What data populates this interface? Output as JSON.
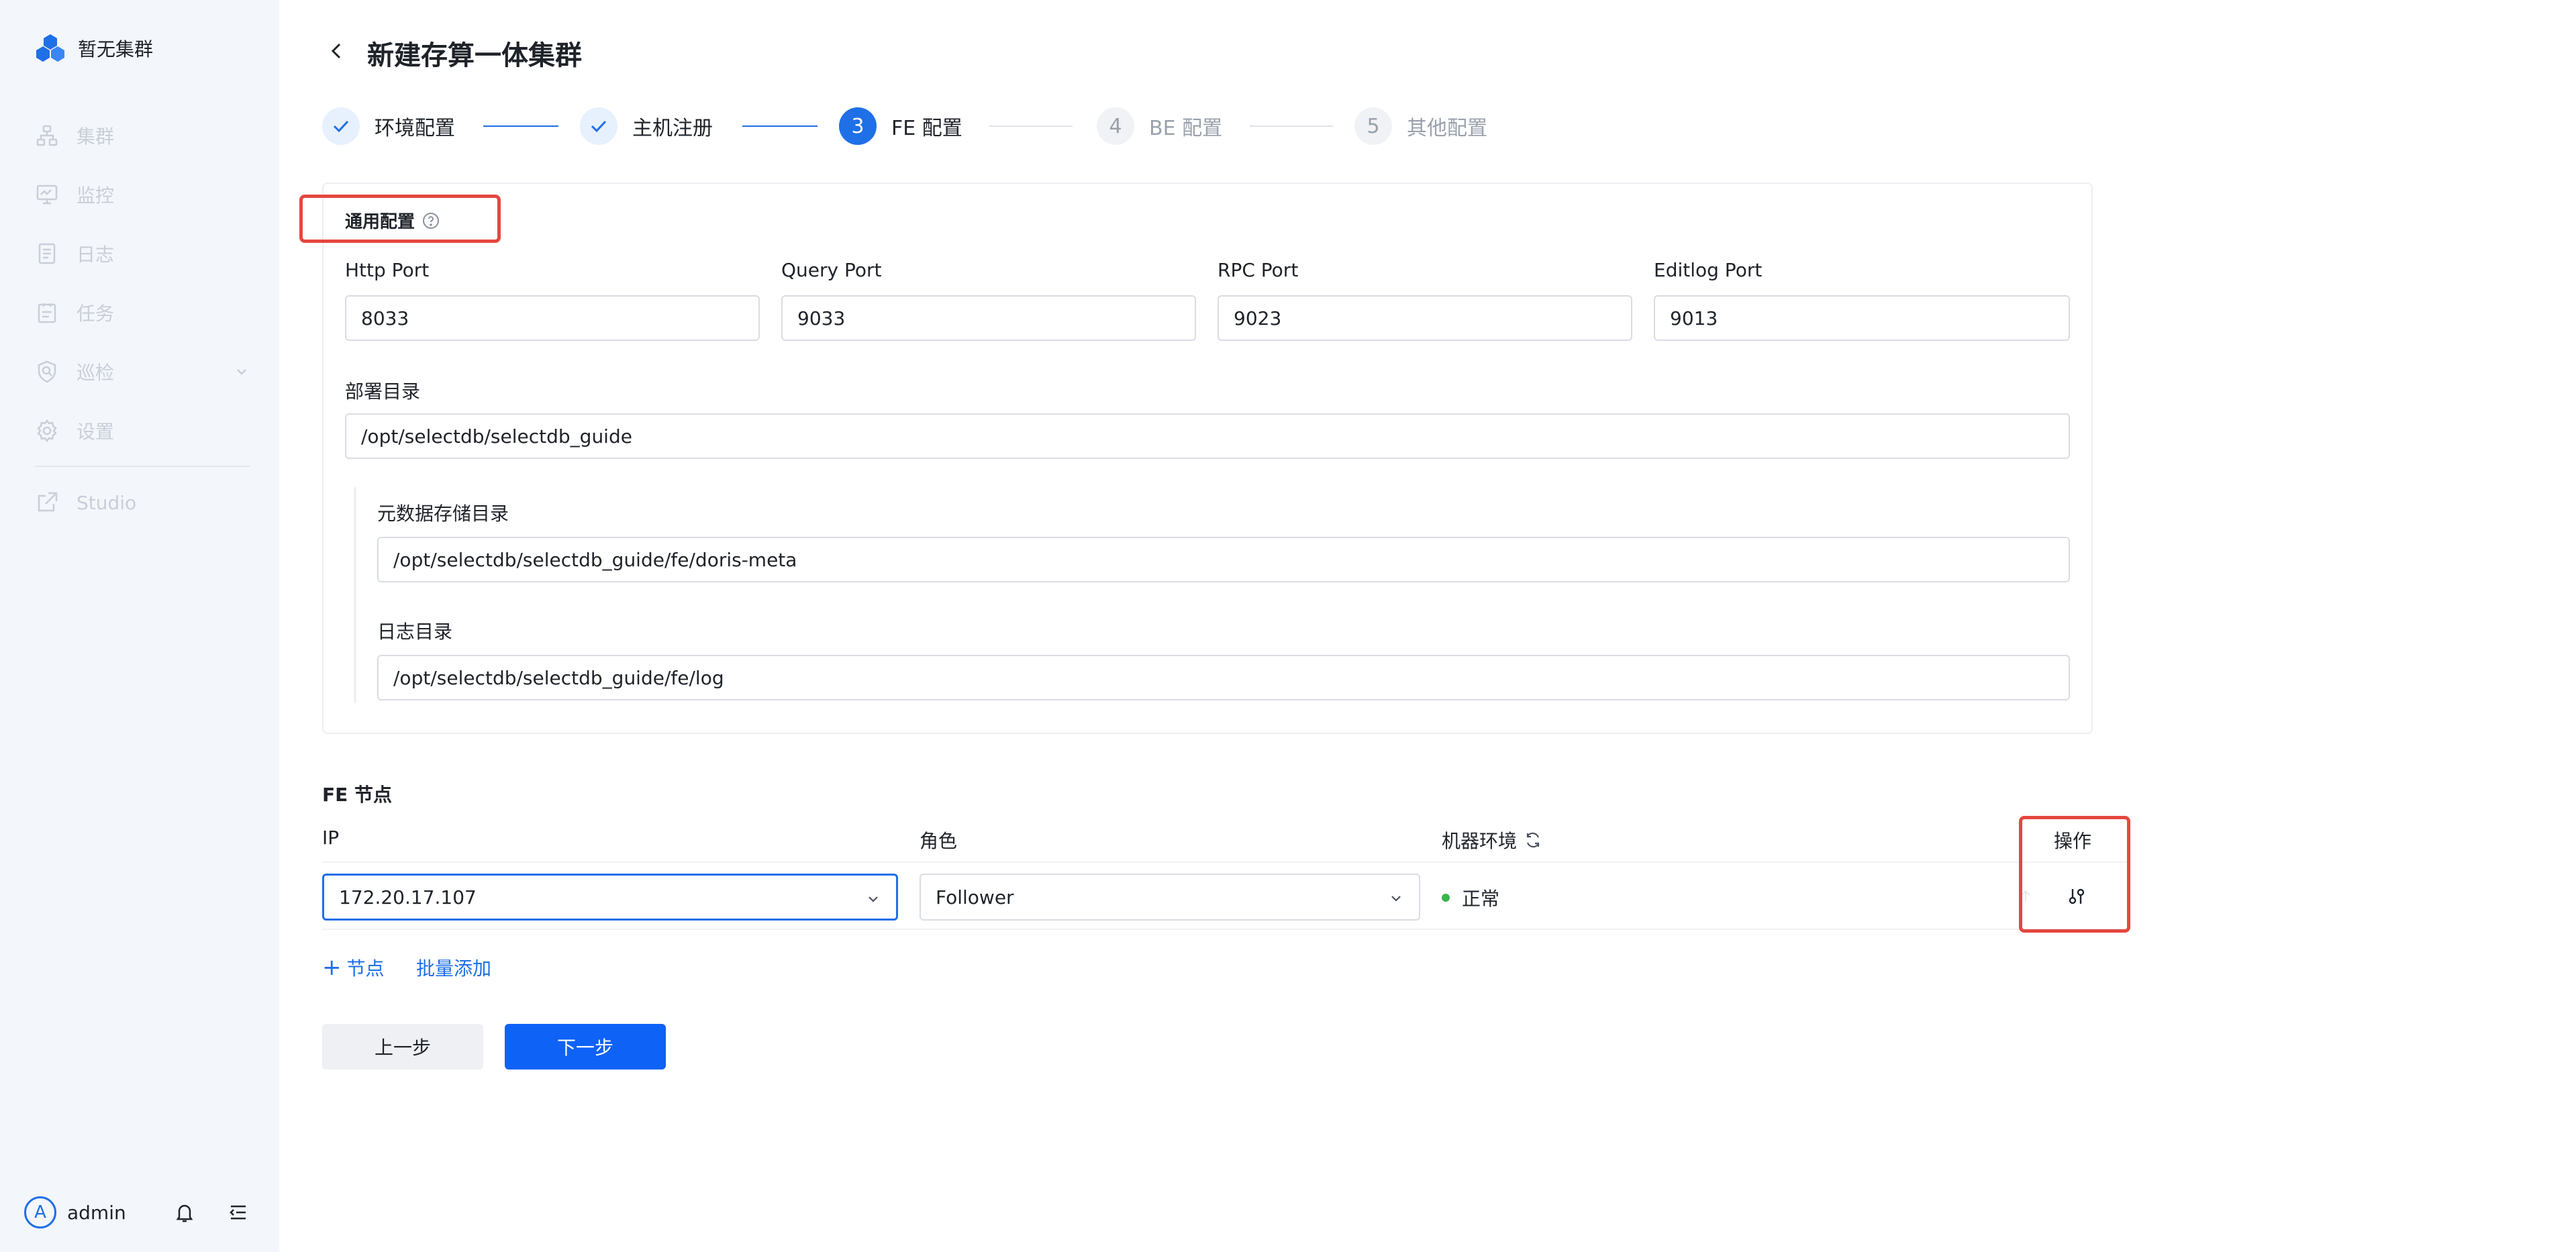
{
  "sidebar": {
    "brand": "暂无集群",
    "items": [
      {
        "label": "集群",
        "icon": "cluster-icon"
      },
      {
        "label": "监控",
        "icon": "monitor-icon"
      },
      {
        "label": "日志",
        "icon": "log-icon"
      },
      {
        "label": "任务",
        "icon": "task-icon"
      },
      {
        "label": "巡检",
        "icon": "inspect-icon"
      },
      {
        "label": "设置",
        "icon": "settings-icon"
      }
    ],
    "studio": {
      "label": "Studio",
      "icon": "external-link-icon"
    },
    "user": {
      "avatar_letter": "A",
      "name": "admin"
    }
  },
  "header": {
    "title": "新建存算一体集群"
  },
  "steps": [
    {
      "number": "1",
      "label": "环境配置",
      "status": "done"
    },
    {
      "number": "2",
      "label": "主机注册",
      "status": "done"
    },
    {
      "number": "3",
      "label": "FE 配置",
      "status": "active"
    },
    {
      "number": "4",
      "label": "BE 配置",
      "status": "pending"
    },
    {
      "number": "5",
      "label": "其他配置",
      "status": "pending"
    }
  ],
  "common_config": {
    "title": "通用配置",
    "ports": [
      {
        "label": "Http Port",
        "value": "8033"
      },
      {
        "label": "Query Port",
        "value": "9033"
      },
      {
        "label": "RPC Port",
        "value": "9023"
      },
      {
        "label": "Editlog Port",
        "value": "9013"
      }
    ],
    "deploy_dir": {
      "label": "部署目录",
      "value": "/opt/selectdb/selectdb_guide"
    },
    "meta_dir": {
      "label": "元数据存储目录",
      "value": "/opt/selectdb/selectdb_guide/fe/doris-meta"
    },
    "log_dir": {
      "label": "日志目录",
      "value": "/opt/selectdb/selectdb_guide/fe/log"
    }
  },
  "fe_nodes": {
    "title": "FE 节点",
    "columns": {
      "ip": "IP",
      "role": "角色",
      "env": "机器环境",
      "ops": "操作"
    },
    "rows": [
      {
        "ip": "172.20.17.107",
        "role": "Follower",
        "env": "正常"
      }
    ],
    "add_node": "节点",
    "batch_add": "批量添加"
  },
  "buttons": {
    "prev": "上一步",
    "next": "下一步"
  },
  "colors": {
    "primary": "#1f6fe6",
    "highlight": "#e5473f",
    "sidebar_bg": "#f3f6fb",
    "success": "#39b54a"
  }
}
